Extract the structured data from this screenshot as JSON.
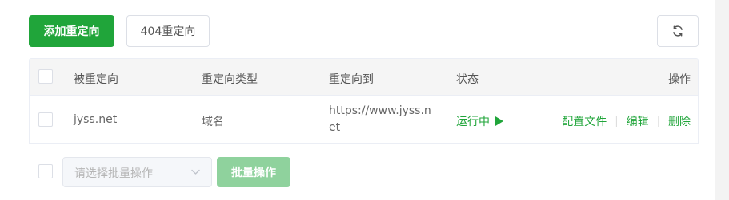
{
  "toolbar": {
    "add_label": "添加重定向",
    "notfound_label": "404重定向"
  },
  "table": {
    "headers": {
      "source": "被重定向",
      "type": "重定向类型",
      "target": "重定向到",
      "status": "状态",
      "actions": "操作"
    },
    "rows": [
      {
        "source": "jyss.net",
        "type": "域名",
        "target_line1": "https://www.jyss.n",
        "target_line2": "et",
        "status": "运行中",
        "actions": {
          "config": "配置文件",
          "edit": "编辑",
          "delete": "删除"
        }
      }
    ]
  },
  "footer": {
    "batch_placeholder": "请选择批量操作",
    "batch_button": "批量操作"
  },
  "colors": {
    "accent": "#20a53a",
    "accent_disabled": "#8fd29d",
    "header_bg": "#f5f5f5"
  },
  "icons": {
    "refresh": "refresh-icon",
    "status": "play-icon",
    "dropdown": "chevron-down-icon"
  }
}
